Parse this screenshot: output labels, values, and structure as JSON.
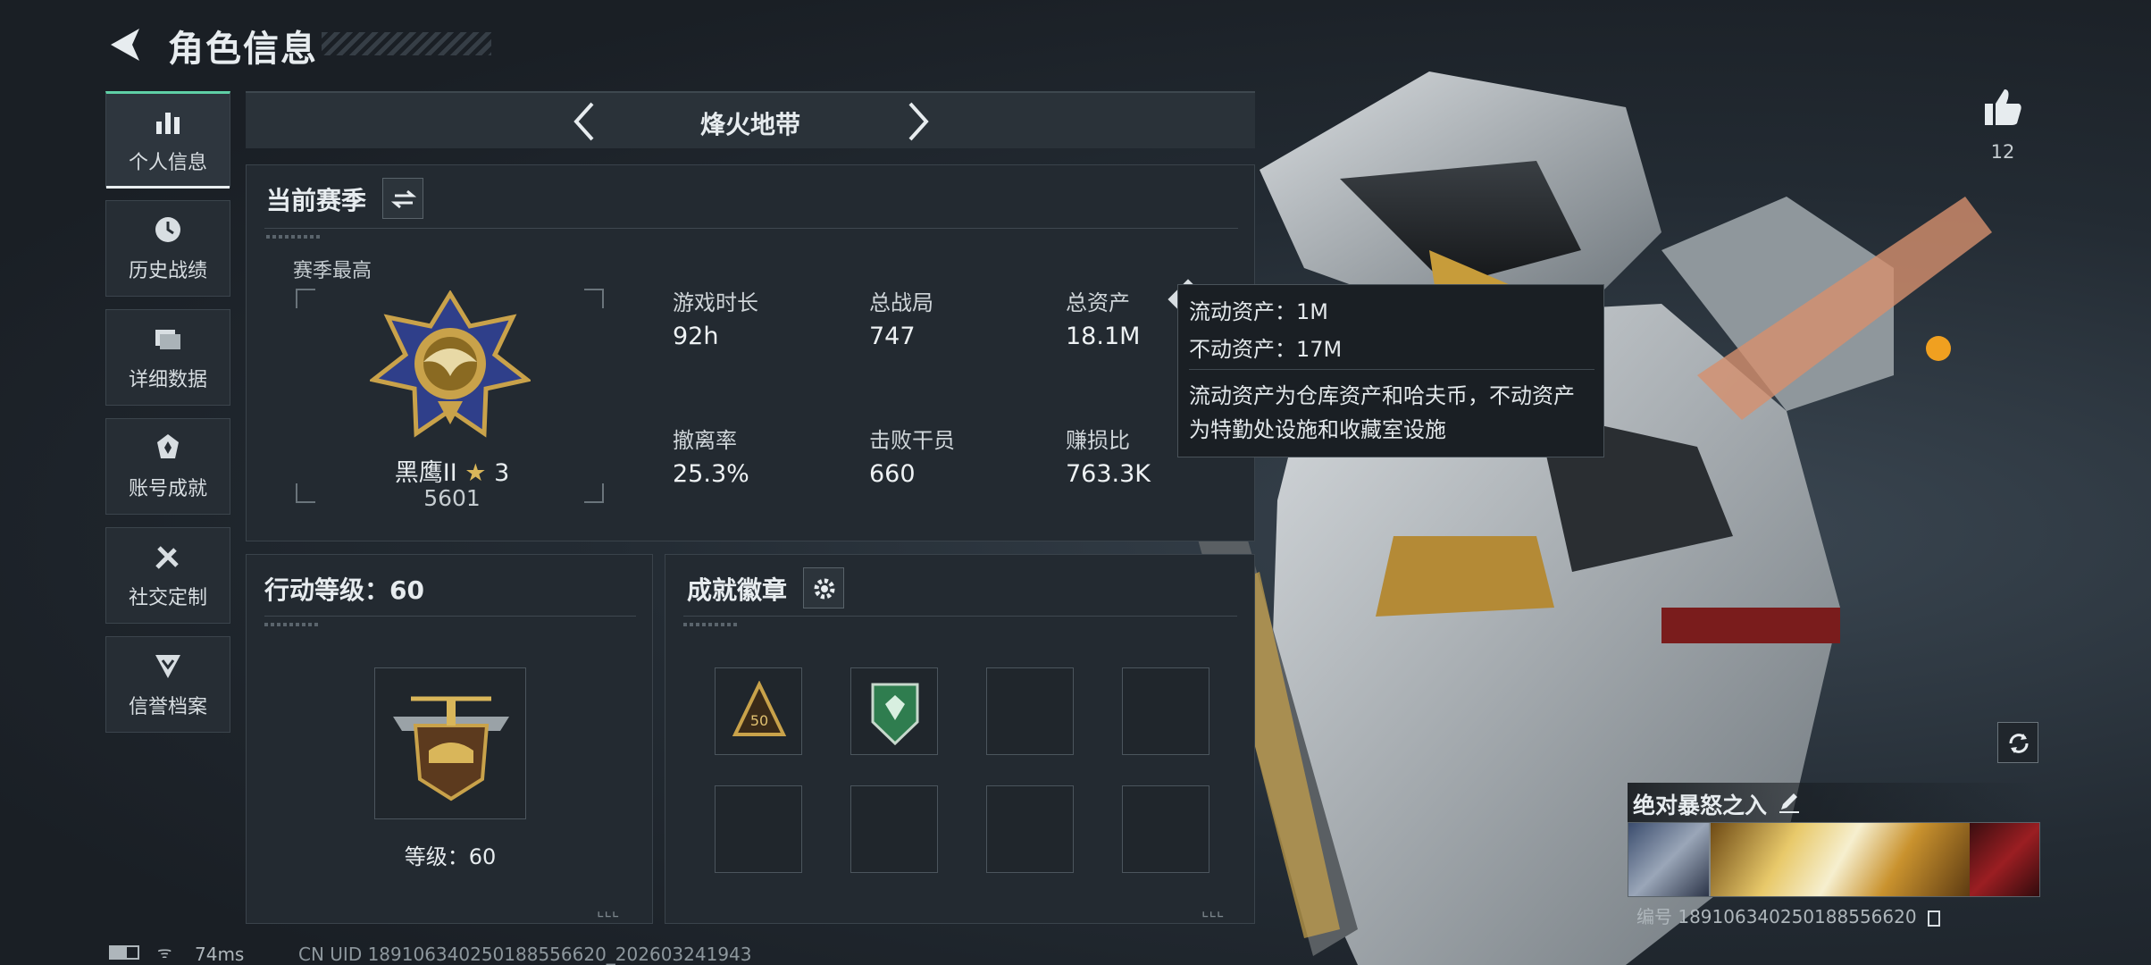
{
  "header": {
    "title": "角色信息"
  },
  "sidebar": {
    "items": [
      {
        "label": "个人信息",
        "icon": "bar-chart-icon",
        "active": true
      },
      {
        "label": "历史战绩",
        "icon": "history-clock-icon"
      },
      {
        "label": "详细数据",
        "icon": "folder-icon"
      },
      {
        "label": "账号成就",
        "icon": "achievement-badge-icon"
      },
      {
        "label": "社交定制",
        "icon": "tools-icon"
      },
      {
        "label": "信誉档案",
        "icon": "shield-chevron-icon"
      }
    ]
  },
  "mode_tab": {
    "label": "烽火地带"
  },
  "season": {
    "title": "当前赛季",
    "best_label": "赛季最高",
    "rank_name": "黑鹰II",
    "rank_stars": "3",
    "rank_score": "5601",
    "stats": [
      {
        "label": "游戏时长",
        "value": "92h"
      },
      {
        "label": "总战局",
        "value": "747"
      },
      {
        "label": "总资产",
        "value": "18.1M"
      },
      {
        "label": "撤离率",
        "value": "25.3%"
      },
      {
        "label": "击败干员",
        "value": "660"
      },
      {
        "label": "赚损比",
        "value": "763.3K"
      }
    ]
  },
  "tooltip": {
    "line1": "流动资产：1M",
    "line2": "不动资产：17M",
    "desc1": "流动资产为仓库资产和哈夫币，不动资产",
    "desc2": "为特勤处设施和收藏室设施"
  },
  "action_level": {
    "title": "行动等级：60",
    "level_label": "等级：60"
  },
  "badges": {
    "title": "成就徽章",
    "slots": [
      "badge-50",
      "badge-green-shield",
      "",
      "",
      "",
      "",
      "",
      ""
    ]
  },
  "likes": {
    "count": "12"
  },
  "loadout": {
    "name": "绝对暴怒之入",
    "id_label": "编号 1891063402501885566​20"
  },
  "footer": {
    "ping": "74ms",
    "uid": "CN UID 18910634025018855662​0_202603241943"
  },
  "colors": {
    "accent": "#5fd0a6",
    "gold": "#c9a24a",
    "green_badge": "#2f7d4f"
  }
}
